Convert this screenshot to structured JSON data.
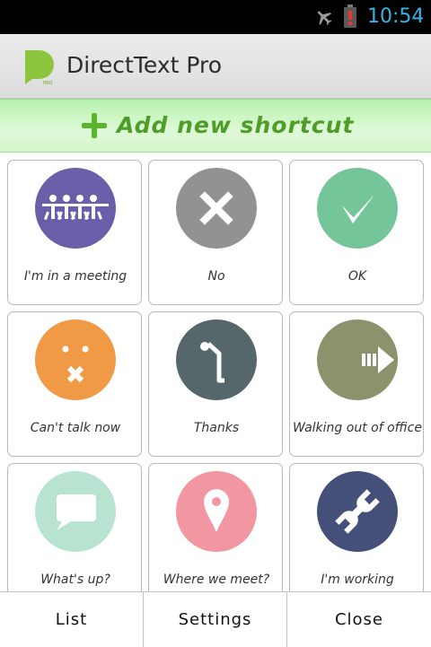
{
  "status_bar": {
    "time": "10:54",
    "icons": [
      "airplane-mode-icon",
      "battery-low-icon"
    ],
    "clock_color": "#33b5e5"
  },
  "app_bar": {
    "title": "DirectText Pro",
    "logo": "directtext-logo-icon",
    "logo_badge": "PRO"
  },
  "add_button": {
    "label": "Add new shortcut",
    "icon": "plus-icon",
    "color": "#59b52b"
  },
  "shortcuts": [
    {
      "label": "I'm in a meeting",
      "icon": "meeting-people-icon",
      "color": "#6b5ea8"
    },
    {
      "label": "No",
      "icon": "x-icon",
      "color": "#929292"
    },
    {
      "label": "OK",
      "icon": "checkmark-icon",
      "color": "#74c69a"
    },
    {
      "label": "Can't talk now",
      "icon": "silent-face-icon",
      "color": "#f09a46"
    },
    {
      "label": "Thanks",
      "icon": "bowing-person-icon",
      "color": "#55676b"
    },
    {
      "label": "Walking out of office",
      "icon": "exit-arrow-icon",
      "color": "#8e926c"
    },
    {
      "label": "What's up?",
      "icon": "speech-bubble-icon",
      "color": "#b8e3d1"
    },
    {
      "label": "Where we meet?",
      "icon": "map-pin-icon",
      "color": "#f296a2"
    },
    {
      "label": "I'm working",
      "icon": "wrench-icon",
      "color": "#44507a"
    }
  ],
  "bottom_bar": {
    "list_label": "List",
    "settings_label": "Settings",
    "close_label": "Close"
  }
}
